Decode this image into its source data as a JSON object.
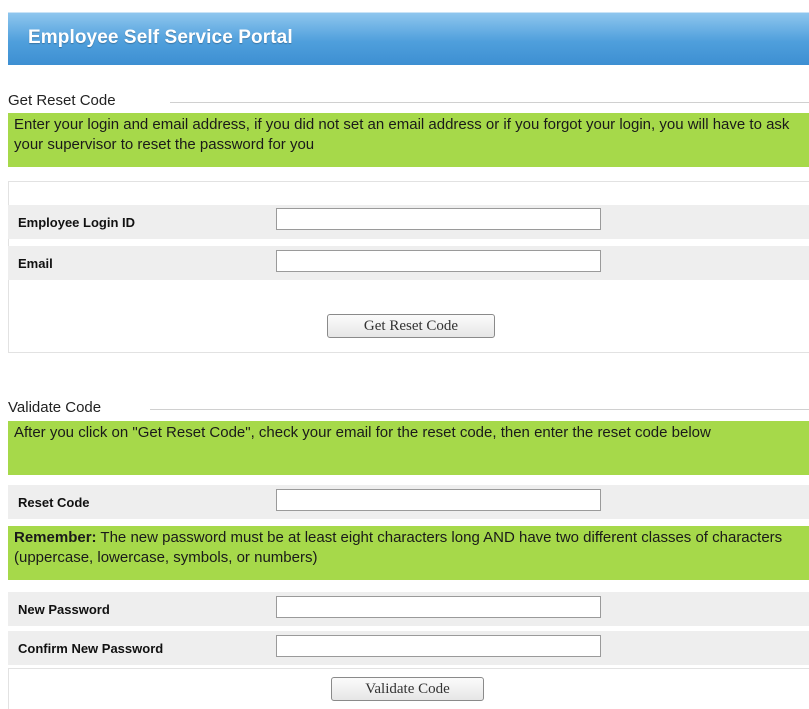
{
  "header": {
    "title": "Employee Self Service Portal",
    "bg_color": "#4f9fdc"
  },
  "get_reset": {
    "legend": "Get Reset Code",
    "note": "Enter your login and email address, if you did not set an email address or if you forgot your login, you will have to ask your supervisor to reset the password for you",
    "login_label": "Employee Login ID",
    "login_value": "",
    "email_label": "Email",
    "email_value": "",
    "button_label": "Get Reset Code"
  },
  "validate": {
    "legend": "Validate Code",
    "note": "After you click on \"Get Reset Code\", check your email for the reset code, then enter the reset code below",
    "reset_code_label": "Reset Code",
    "reset_code_value": "",
    "remember_bold": "Remember:",
    "remember_text": " The new password must be at least eight characters long AND have two different classes of characters (uppercase, lowercase, symbols, or numbers)",
    "new_password_label": "New Password",
    "new_password_value": "",
    "confirm_password_label": "Confirm New Password",
    "confirm_password_value": "",
    "button_label": "Validate Code"
  },
  "colors": {
    "note_bg": "#a6d94a",
    "row_bg": "#eeeeee"
  }
}
